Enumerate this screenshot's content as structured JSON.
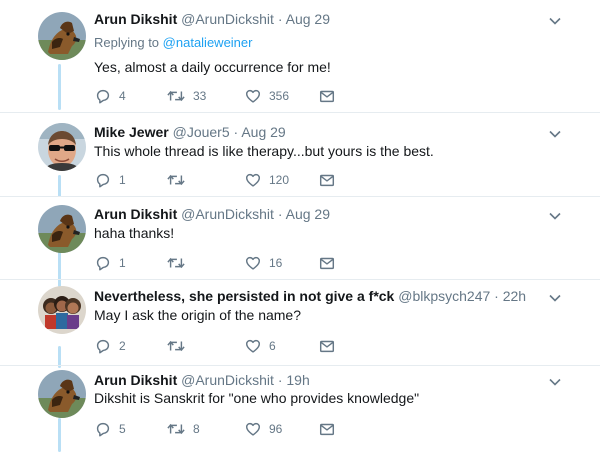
{
  "tweets": [
    {
      "author": "Arun Dikshit",
      "handle": "@ArunDickshit",
      "separator": "·",
      "time": "Aug 29",
      "replying_prefix": "Replying to",
      "replying_to": "@natalieweiner",
      "text": "Yes, almost a daily occurrence for me!",
      "replies": "4",
      "retweets": "33",
      "likes": "356"
    },
    {
      "author": "Mike Jewer",
      "handle": "@Jouer5",
      "separator": "·",
      "time": "Aug 29",
      "text": "This whole thread is like therapy...but yours is the best.",
      "replies": "1",
      "retweets": "",
      "likes": "120"
    },
    {
      "author": "Arun Dikshit",
      "handle": "@ArunDickshit",
      "separator": "·",
      "time": "Aug 29",
      "text": "haha thanks!",
      "replies": "1",
      "retweets": "",
      "likes": "16"
    },
    {
      "author": "Nevertheless, she persisted in not give a f*ck",
      "handle": "@blkpsych247",
      "separator": "·",
      "time": "22h",
      "text": "May I ask the origin of the name?",
      "replies": "2",
      "retweets": "",
      "likes": "6"
    },
    {
      "author": "Arun Dikshit",
      "handle": "@ArunDickshit",
      "separator": "·",
      "time": "19h",
      "text": "Dikshit is Sanskrit for \"one who provides knowledge\"",
      "replies": "5",
      "retweets": "8",
      "likes": "96"
    }
  ],
  "icons": {
    "reply": "reply-icon",
    "retweet": "retweet-icon",
    "like": "heart-icon",
    "message": "envelope-icon",
    "more": "chevron-down-icon"
  },
  "colors": {
    "text": "#14171a",
    "secondary": "#657786",
    "link": "#1da1f2",
    "thread_line": "#b9dff5",
    "divider": "#e6ecf0"
  }
}
